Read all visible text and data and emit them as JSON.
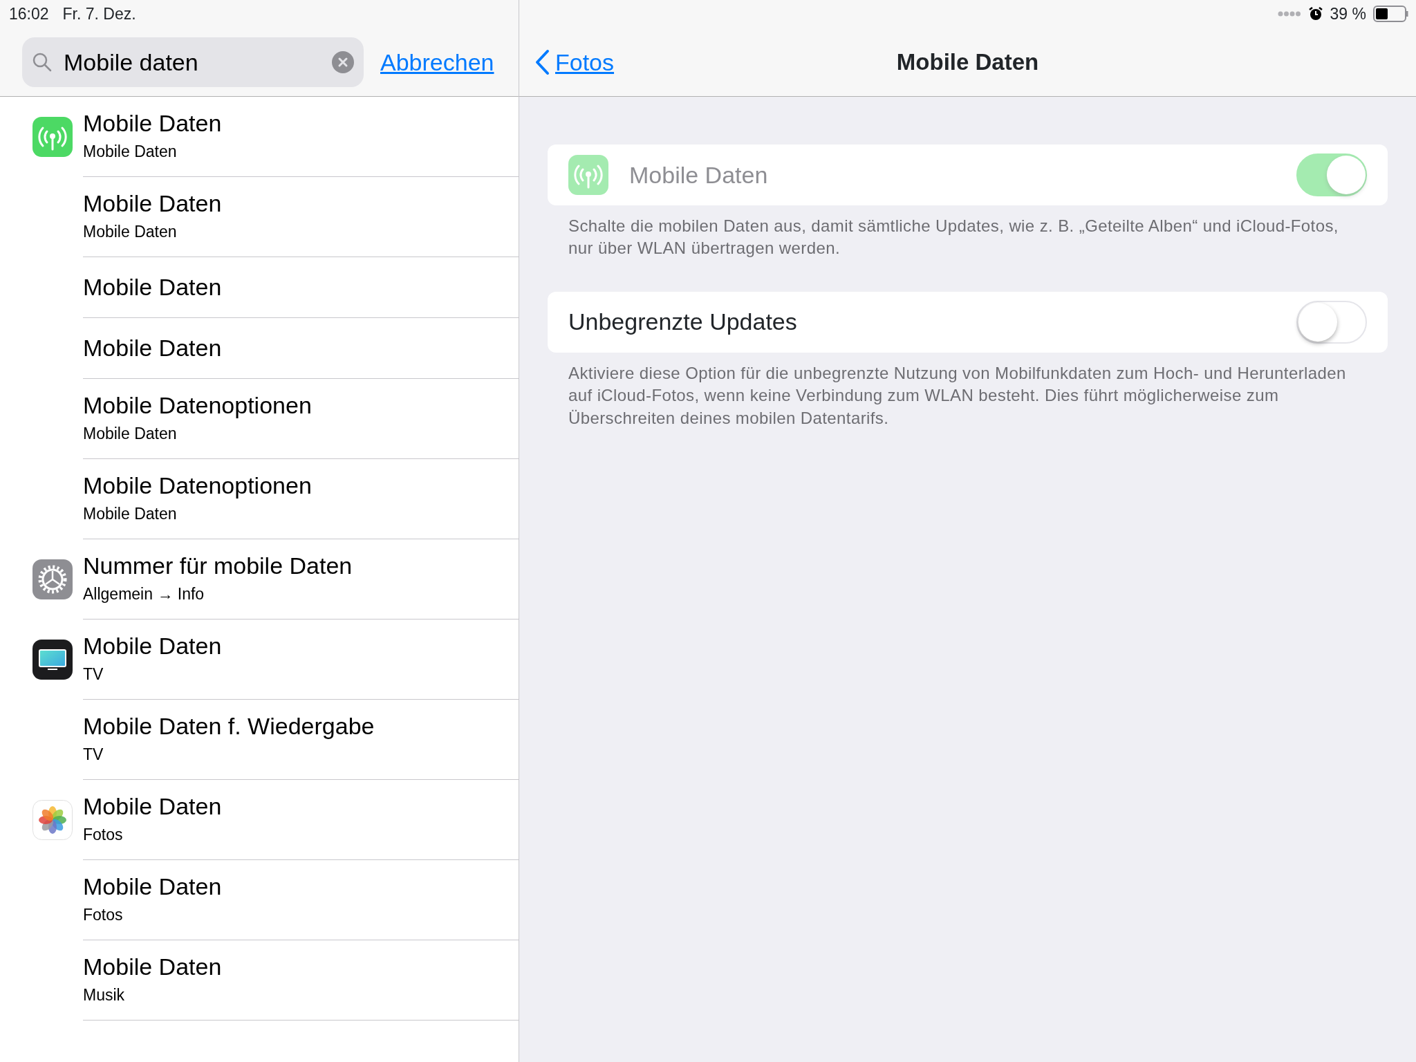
{
  "status_bar": {
    "time": "16:02",
    "date": "Fr. 7. Dez.",
    "battery": "39 %"
  },
  "search": {
    "value": "Mobile daten",
    "cancel": "Abbrechen"
  },
  "results": [
    {
      "title": "Mobile Daten",
      "subtitle": "Mobile Daten",
      "kind": "cellular"
    },
    {
      "title": "Mobile Daten",
      "subtitle": "Mobile Daten"
    },
    {
      "title": "Mobile Daten"
    },
    {
      "title": "Mobile Daten"
    },
    {
      "title": "Mobile Datenoptionen",
      "subtitle": "Mobile Daten"
    },
    {
      "title": "Mobile Datenoptionen",
      "subtitle": "Mobile Daten"
    },
    {
      "title": "Nummer für mobile Daten",
      "subtitle": "Allgemein → Info",
      "kind": "settings"
    },
    {
      "title": "Mobile Daten",
      "subtitle": "TV",
      "kind": "tv"
    },
    {
      "title": "Mobile Daten f. Wiedergabe",
      "subtitle": "TV"
    },
    {
      "title": "Mobile Daten",
      "subtitle": "Fotos",
      "kind": "photos"
    },
    {
      "title": "Mobile Daten",
      "subtitle": "Fotos"
    },
    {
      "title": "Mobile Daten",
      "subtitle": "Musik"
    }
  ],
  "nav": {
    "back": "Fotos",
    "title": "Mobile Daten"
  },
  "settings": [
    {
      "label": "Mobile Daten",
      "kind": "cellular",
      "on": true,
      "disabled": true,
      "footer": "Schalte die mobilen Daten aus, damit sämtliche Updates, wie z. B. „Geteilte Alben“ und iCloud-Fotos, nur über WLAN übertragen werden."
    },
    {
      "label": "Unbegrenzte Updates",
      "on": false,
      "disabled": false,
      "footer": "Aktiviere diese Option für die unbegrenzte Nutzung von Mobilfunkdaten zum Hoch- und Herunterladen auf iCloud-Fotos, wenn keine Verbindung zum WLAN besteht. Dies führt möglicherweise zum Überschreiten deines mobilen Datentarifs."
    }
  ]
}
